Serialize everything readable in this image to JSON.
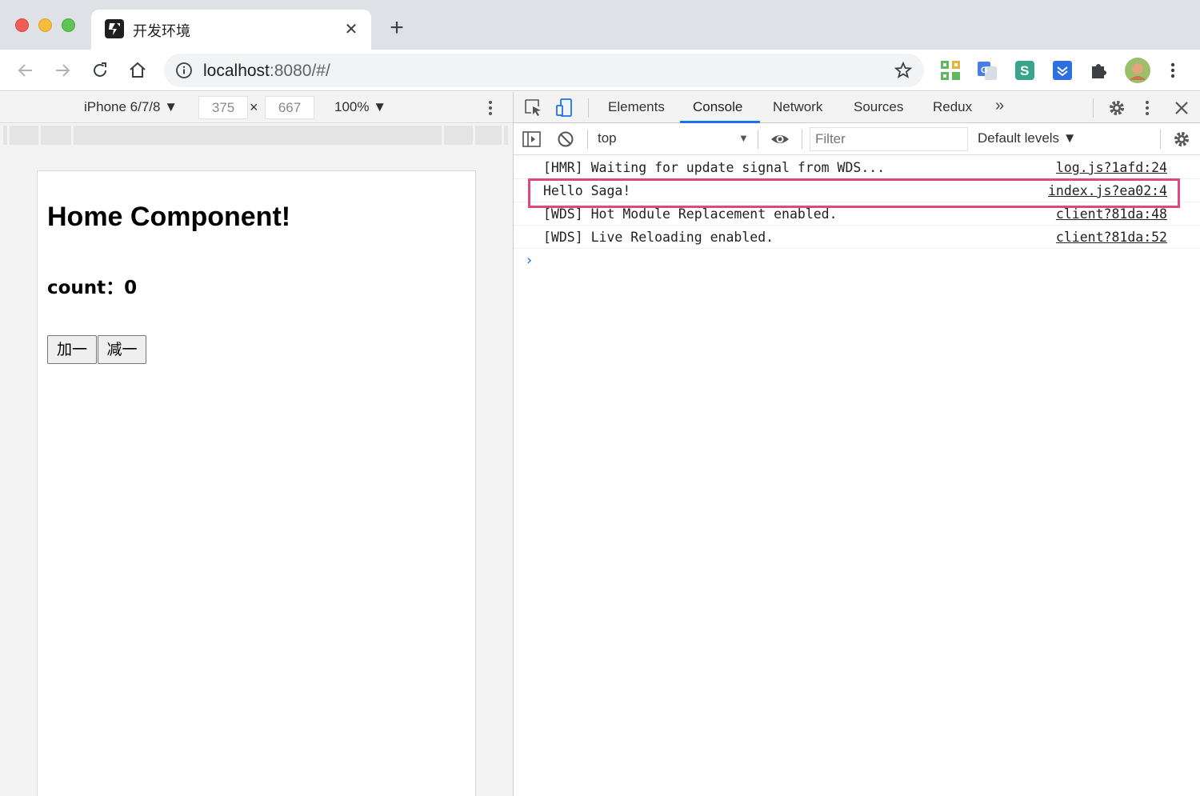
{
  "browser": {
    "tab_title": "开发环境",
    "url_host": "localhost",
    "url_path": ":8080/#/"
  },
  "device_toolbar": {
    "device": "iPhone 6/7/8 ▼",
    "width": "375",
    "height": "667",
    "times": "×",
    "zoom": "100% ▼"
  },
  "page": {
    "title": "Home Component!",
    "count_label": "count：0",
    "add_button": "加一",
    "subtract_button": "减一"
  },
  "devtools": {
    "tabs": [
      "Elements",
      "Console",
      "Network",
      "Sources",
      "Redux"
    ],
    "more_tabs": "»",
    "context": "top",
    "filter_placeholder": "Filter",
    "levels": "Default levels ▼",
    "logs": [
      {
        "message": "[HMR] Waiting for update signal from WDS...",
        "source": "log.js?1afd:24"
      },
      {
        "message": "Hello Saga!",
        "source": "index.js?ea02:4"
      },
      {
        "message": "[WDS] Hot Module Replacement enabled.",
        "source": "client?81da:48"
      },
      {
        "message": "[WDS] Live Reloading enabled.",
        "source": "client?81da:52"
      }
    ],
    "prompt": "›",
    "highlight_color": "#e0467f",
    "accent_color": "#1a73e8"
  }
}
